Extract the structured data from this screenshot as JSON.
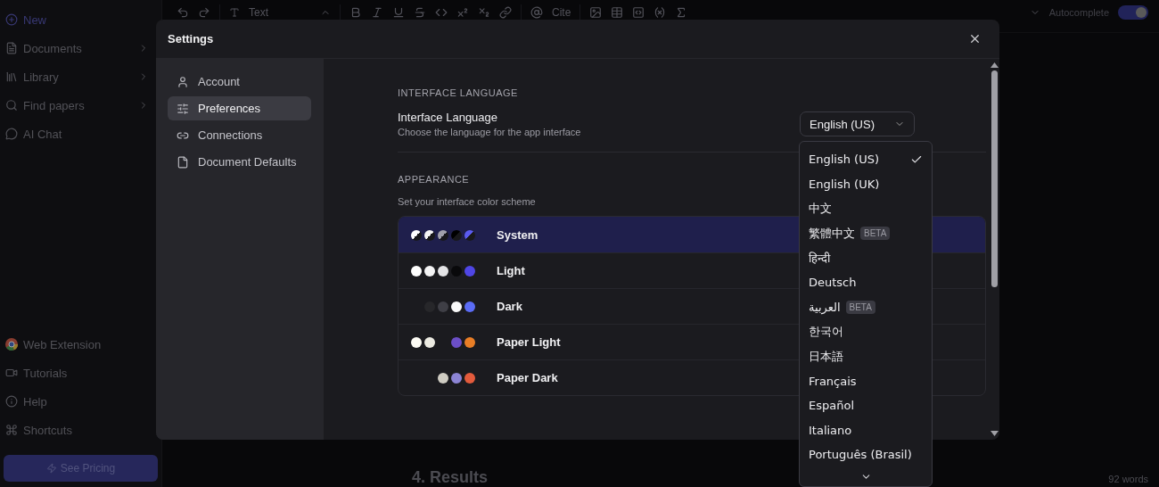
{
  "sidebar": {
    "items": [
      {
        "label": "New",
        "kind": "accent"
      },
      {
        "label": "Documents",
        "kind": "expand"
      },
      {
        "label": "Library",
        "kind": "expand"
      },
      {
        "label": "Find papers",
        "kind": "expand"
      },
      {
        "label": "AI Chat",
        "kind": "plain"
      }
    ],
    "footer_items": [
      "Web Extension",
      "Tutorials",
      "Help",
      "Shortcuts"
    ],
    "pricing_button": "See Pricing"
  },
  "toolbar": {
    "style_select": "Text",
    "cite": "Cite",
    "autocomplete": {
      "label": "Autocomplete",
      "on": true
    }
  },
  "editor": {
    "heading": "4. Results",
    "word_count": "92 words"
  },
  "settings": {
    "title": "Settings",
    "nav": [
      {
        "label": "Account",
        "selected": false
      },
      {
        "label": "Preferences",
        "selected": true
      },
      {
        "label": "Connections",
        "selected": false
      },
      {
        "label": "Document Defaults",
        "selected": false
      }
    ],
    "language": {
      "section": "INTERFACE LANGUAGE",
      "label": "Interface Language",
      "description": "Choose the language for the app interface",
      "value": "English (US)",
      "options": [
        {
          "label": "English (US)",
          "selected": true
        },
        {
          "label": "English (UK)",
          "selected": false
        },
        {
          "label": "中文",
          "selected": false
        },
        {
          "label": "繁體中文",
          "selected": false,
          "badge": "BETA"
        },
        {
          "label": "हिन्दी",
          "selected": false
        },
        {
          "label": "Deutsch",
          "selected": false
        },
        {
          "label": "العربية",
          "selected": false,
          "badge": "BETA"
        },
        {
          "label": "한국어",
          "selected": false
        },
        {
          "label": "日本語",
          "selected": false
        },
        {
          "label": "Français",
          "selected": false
        },
        {
          "label": "Español",
          "selected": false
        },
        {
          "label": "Italiano",
          "selected": false
        },
        {
          "label": "Português (Brasil)",
          "selected": false
        }
      ]
    },
    "appearance": {
      "section": "APPEARANCE",
      "description": "Set your interface color scheme",
      "themes": [
        {
          "label": "System",
          "selected": true,
          "kind": "split",
          "swatches": [
            {
              "color": "#ffffff"
            },
            {
              "color": "#f4f4f5"
            },
            {
              "color": "#a1a1aa"
            },
            {
              "color": "#000000"
            },
            {
              "color": "#5b5bf0"
            }
          ]
        },
        {
          "label": "Light",
          "selected": false,
          "kind": "solid",
          "swatches": [
            {
              "color": "#ffffff"
            },
            {
              "color": "#f4f4f5"
            },
            {
              "color": "#e4e4e7"
            },
            {
              "color": "#09090b"
            },
            {
              "color": "#4f46e5"
            }
          ]
        },
        {
          "label": "Dark",
          "selected": false,
          "kind": "solid",
          "swatches": [
            {
              "kind": "gap"
            },
            {
              "color": "#27272a"
            },
            {
              "color": "#3f3f46"
            },
            {
              "color": "#fafafa"
            },
            {
              "color": "#5b6cf5"
            }
          ]
        },
        {
          "label": "Paper Light",
          "selected": false,
          "kind": "solid",
          "swatches": [
            {
              "color": "#fdfcf5"
            },
            {
              "color": "#ecebe2"
            },
            {
              "kind": "gap"
            },
            {
              "color": "#6c4fc7"
            },
            {
              "color": "#e97e26"
            }
          ]
        },
        {
          "label": "Paper Dark",
          "selected": false,
          "kind": "solid",
          "swatches": [
            {
              "kind": "gap"
            },
            {
              "kind": "gap"
            },
            {
              "color": "#cfccc2"
            },
            {
              "color": "#8c84d4"
            },
            {
              "color": "#e35b3c"
            }
          ]
        }
      ]
    }
  }
}
